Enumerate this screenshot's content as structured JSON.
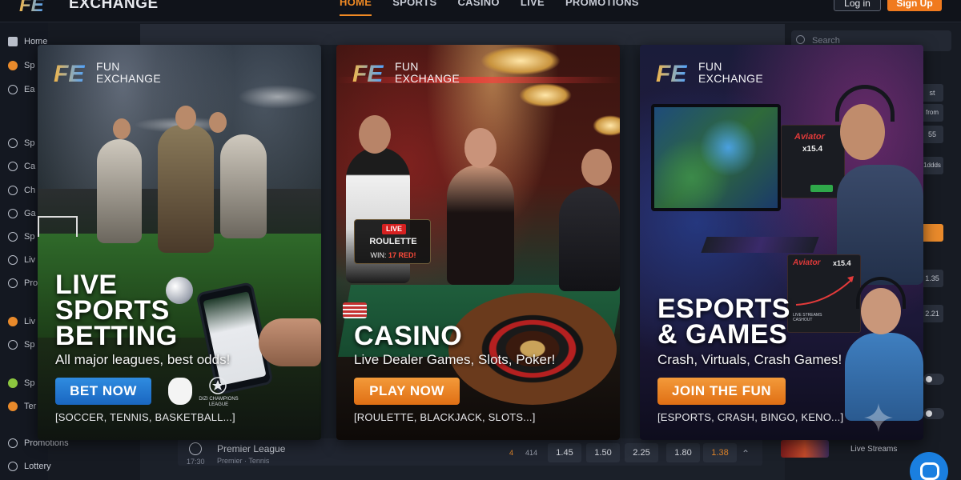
{
  "header": {
    "brand": "EXCHANGE",
    "nav": [
      "HOME",
      "SPORTS",
      "CASINO",
      "LIVE",
      "PROMOTIONS"
    ],
    "active_nav": "HOME",
    "login_label": "Log in",
    "signup_label": "Sign Up"
  },
  "sidebar": {
    "home": "Home",
    "items_partial": [
      "Sp",
      "Ea",
      "Sp",
      "Ca",
      "Ch",
      "Ga",
      "Sp",
      "Liv",
      "Pro",
      "Liv",
      "Sp",
      "Sp",
      "Ter"
    ],
    "promotions": "Promotions",
    "lottery": "Lottery"
  },
  "right_panel": {
    "search_placeholder": "Search",
    "chips": [
      "st",
      "from nts",
      "55",
      "1ddds",
      "1.35",
      "2.21"
    ],
    "live_streams_label": "Live Streams"
  },
  "background_row": {
    "team": "Premier League",
    "sub": "Premier · Tennis",
    "time": "17:30",
    "count_left": "4",
    "count_right": "414",
    "odds": [
      "1.45",
      "1.50",
      "2.25",
      "1.80",
      "1.38"
    ]
  },
  "cards": {
    "brand_line1": "FUN",
    "brand_line2": "EXCHANGE",
    "sports": {
      "title_line1": "LIVE",
      "title_line2": "SPORTS",
      "title_line3": "BETTING",
      "subtitle": "All major leagues, best odds!",
      "cta": "BET NOW",
      "footer": "[SOCCER, TENNIS, BASKETBALL...]",
      "ucl_text": "DIZI CHAMPIONS LEAGUE"
    },
    "casino": {
      "title": "CASINO",
      "subtitle": "Live Dealer Games, Slots, Poker!",
      "cta": "PLAY NOW",
      "footer": "[ROULETTE, BLACKJACK, SLOTS...]",
      "live_tag": "LIVE",
      "live_game": "ROULETTE",
      "live_win_prefix": "WIN:",
      "live_win_value": "17 RED!"
    },
    "esports": {
      "title_line1": "ESPORTS",
      "title_line2": "& GAMES",
      "subtitle": "Crash, Virtuals, Crash Games!",
      "cta": "JOIN THE FUN",
      "footer": "[ESPORTS, CRASH, BINGO, KENO...]",
      "aviator_title": "Aviator",
      "aviator_mult": "x15.4",
      "aviator_small": "LIVE STREAMS\nCASHOUT"
    }
  },
  "colors": {
    "accent_orange": "#f07a1e",
    "cta_blue": "#2f8ce0",
    "live_red": "#d62020"
  }
}
